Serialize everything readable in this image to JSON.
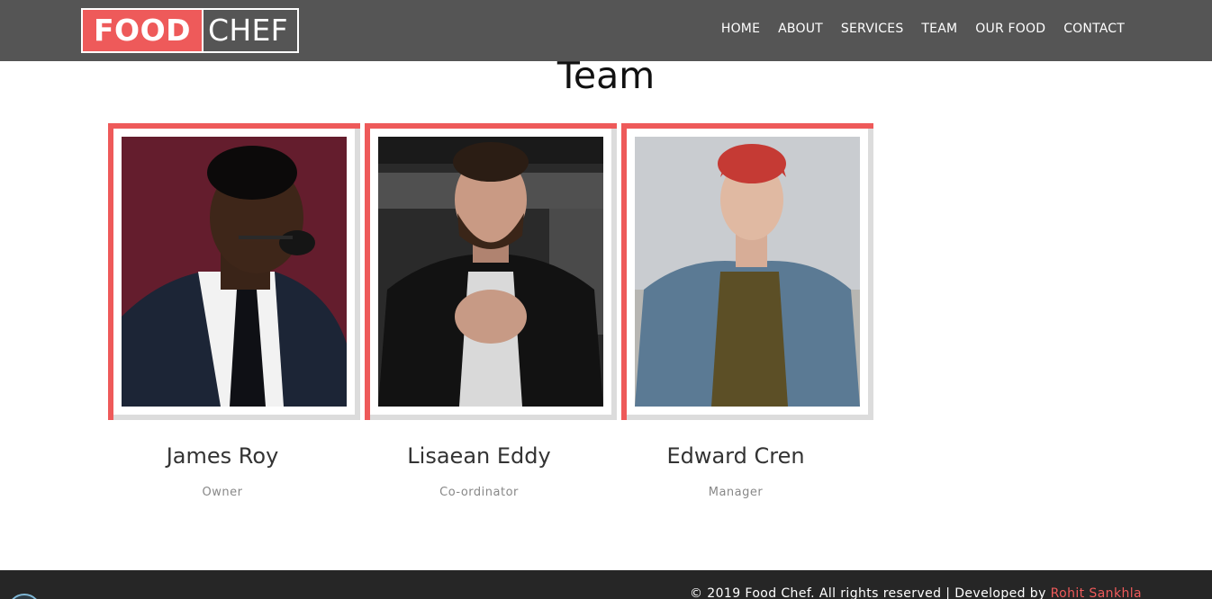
{
  "header": {
    "logo_food": "FOOD",
    "logo_chef": "CHEF",
    "nav": [
      {
        "label": "HOME"
      },
      {
        "label": "ABOUT"
      },
      {
        "label": "SERVICES"
      },
      {
        "label": "TEAM"
      },
      {
        "label": "OUR FOOD"
      },
      {
        "label": "CONTACT"
      }
    ]
  },
  "section": {
    "title": "Team"
  },
  "team": [
    {
      "name": "James Roy",
      "role": "Owner"
    },
    {
      "name": "Lisaean Eddy",
      "role": "Co-ordinator"
    },
    {
      "name": "Edward Cren",
      "role": "Manager"
    }
  ],
  "footer": {
    "copyright": "© 2019 Food Chef. All rights reserved | Developed by ",
    "developer": "Rohit Sankhla"
  },
  "colors": {
    "accent": "#ee5a5a",
    "header_bg": "#555555",
    "footer_bg": "#262626",
    "frame_gray": "#dcdcdc"
  }
}
